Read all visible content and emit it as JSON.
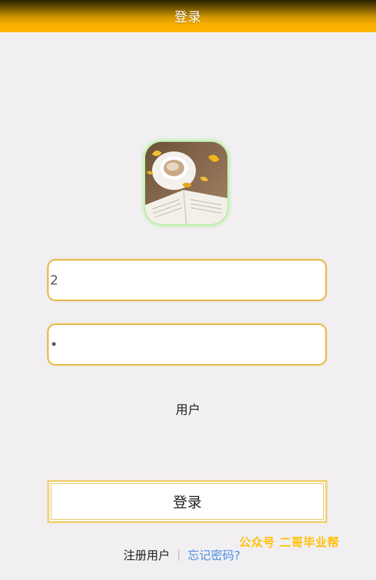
{
  "header": {
    "title": "登录"
  },
  "avatar": {
    "description_icon": "coffee-book-photo"
  },
  "form": {
    "username_value": "2",
    "password_value": "•",
    "role_label": "用户",
    "login_label": "登录"
  },
  "links": {
    "register": "注册用户",
    "separator": "|",
    "forgot": "忘记密码?"
  },
  "watermark": {
    "text": "公众号 二哥毕业帮"
  },
  "colors": {
    "header": "#ffb300",
    "accent_border": "#e6b53a",
    "background": "#f1eff1",
    "link": "#4a8ee6",
    "watermark": "#ffc20e"
  }
}
